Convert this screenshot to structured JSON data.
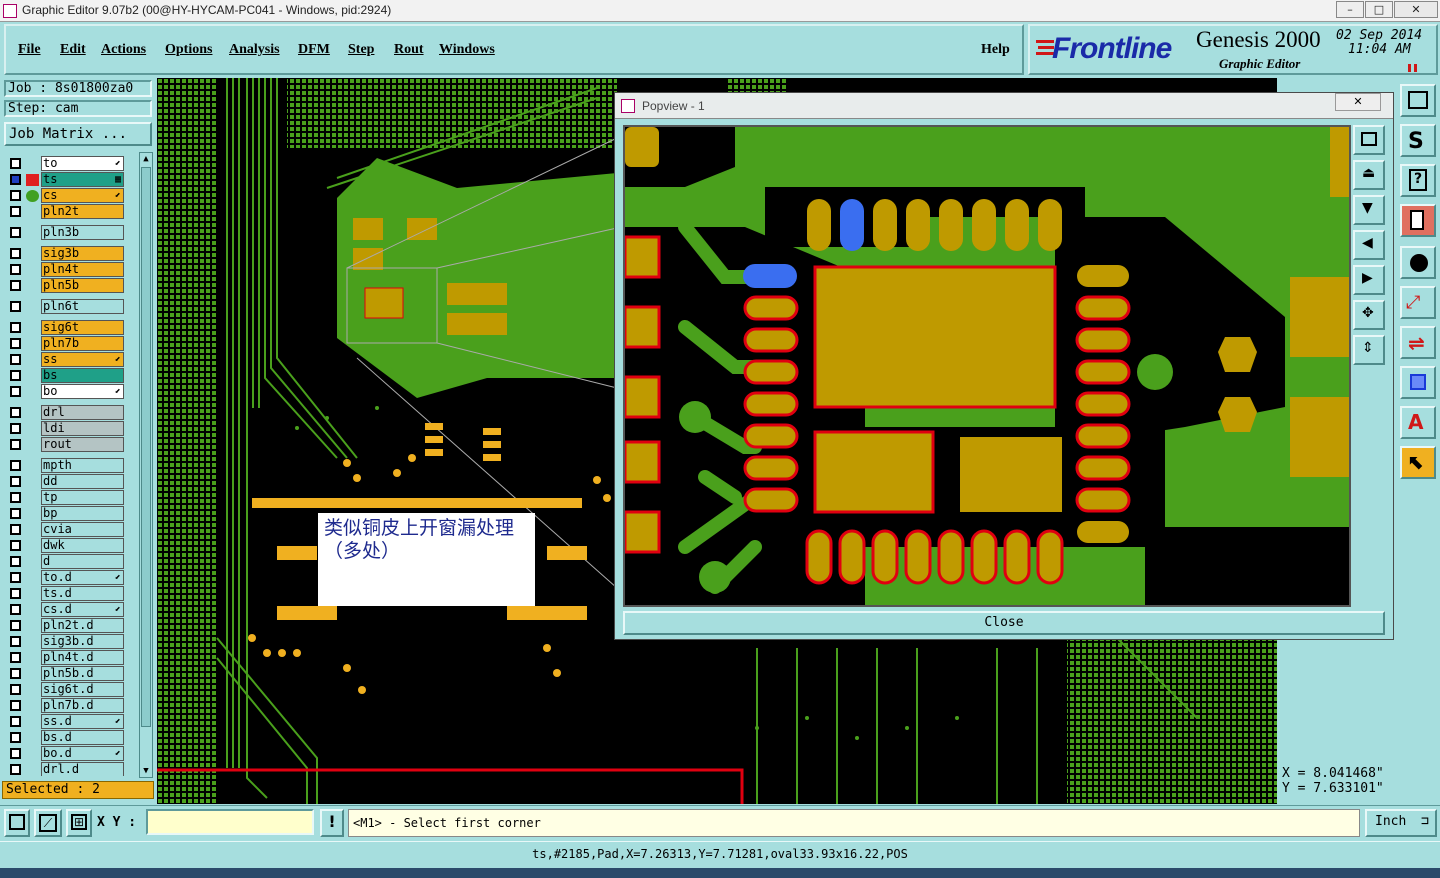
{
  "window": {
    "title": "Graphic Editor 9.07b2 (00@HY-HYCAM-PC041 - Windows, pid:2924)",
    "controls": [
      "–",
      "□",
      "✕"
    ]
  },
  "menu": {
    "items": [
      {
        "label": "File"
      },
      {
        "label": "Edit"
      },
      {
        "label": "Actions"
      },
      {
        "label": "Options"
      },
      {
        "label": "Analysis"
      },
      {
        "label": "DFM"
      },
      {
        "label": "Step"
      },
      {
        "label": "Rout"
      },
      {
        "label": "Windows"
      }
    ],
    "help": "Help"
  },
  "brand": {
    "logo": "Frontline",
    "product": "Genesis 2000",
    "subtitle": "Graphic Editor",
    "date": "02 Sep 2014",
    "time": "11:04 AM"
  },
  "job": {
    "job_label": "Job : 8s01800za0",
    "step_label": "Step: cam",
    "matrix_button": "Job Matrix ..."
  },
  "layers": [
    {
      "name": "to",
      "color": "#ffffff",
      "flag": "⬋"
    },
    {
      "name": "ts",
      "color": "#1fa088",
      "flag": "▦",
      "active": true
    },
    {
      "name": "cs",
      "color": "#f0b020",
      "flag": "⬋",
      "work": true
    },
    {
      "name": "pln2t",
      "color": "#f0b020",
      "flag": ""
    },
    {
      "name": "pln3b",
      "color": "#a6dede",
      "flag": "",
      "gap": true
    },
    {
      "name": "sig3b",
      "color": "#f0b020",
      "flag": "",
      "gap": true
    },
    {
      "name": "pln4t",
      "color": "#f0b020",
      "flag": ""
    },
    {
      "name": "pln5b",
      "color": "#f0b020",
      "flag": ""
    },
    {
      "name": "pln6t",
      "color": "#a6dede",
      "flag": "",
      "gap": true
    },
    {
      "name": "sig6t",
      "color": "#f0b020",
      "flag": "",
      "gap": true
    },
    {
      "name": "pln7b",
      "color": "#f0b020",
      "flag": ""
    },
    {
      "name": "ss",
      "color": "#f0b020",
      "flag": "⬋"
    },
    {
      "name": "bs",
      "color": "#1fa088",
      "flag": ""
    },
    {
      "name": "bo",
      "color": "#ffffff",
      "flag": "⬋"
    },
    {
      "name": "drl",
      "color": "#b4c4c4",
      "flag": "",
      "gap": true
    },
    {
      "name": "ldi",
      "color": "#b4c4c4",
      "flag": ""
    },
    {
      "name": "rout",
      "color": "#b4c4c4",
      "flag": ""
    },
    {
      "name": "mpth",
      "color": "#a6dede",
      "flag": "",
      "gap": true
    },
    {
      "name": "dd",
      "color": "#a6dede",
      "flag": ""
    },
    {
      "name": "tp",
      "color": "#a6dede",
      "flag": ""
    },
    {
      "name": "bp",
      "color": "#a6dede",
      "flag": ""
    },
    {
      "name": "cvia",
      "color": "#a6dede",
      "flag": ""
    },
    {
      "name": "dwk",
      "color": "#a6dede",
      "flag": ""
    },
    {
      "name": "d",
      "color": "#a6dede",
      "flag": ""
    },
    {
      "name": "to.d",
      "color": "#a6dede",
      "flag": "⬋"
    },
    {
      "name": "ts.d",
      "color": "#a6dede",
      "flag": ""
    },
    {
      "name": "cs.d",
      "color": "#a6dede",
      "flag": "⬋"
    },
    {
      "name": "pln2t.d",
      "color": "#a6dede",
      "flag": ""
    },
    {
      "name": "sig3b.d",
      "color": "#a6dede",
      "flag": ""
    },
    {
      "name": "pln4t.d",
      "color": "#a6dede",
      "flag": ""
    },
    {
      "name": "pln5b.d",
      "color": "#a6dede",
      "flag": ""
    },
    {
      "name": "sig6t.d",
      "color": "#a6dede",
      "flag": ""
    },
    {
      "name": "pln7b.d",
      "color": "#a6dede",
      "flag": ""
    },
    {
      "name": "ss.d",
      "color": "#a6dede",
      "flag": "⬋"
    },
    {
      "name": "bs.d",
      "color": "#a6dede",
      "flag": ""
    },
    {
      "name": "bo.d",
      "color": "#a6dede",
      "flag": "⬋"
    },
    {
      "name": "drl.d",
      "color": "#a6dede",
      "flag": ""
    }
  ],
  "selected": "Selected : 2",
  "popview": {
    "title": "Popview - 1",
    "close_label": "Close"
  },
  "annotation": "类似铜皮上开窗漏处理（多处）",
  "coords": {
    "x": "X = 8.041468\"",
    "y": "Y = 7.633101\""
  },
  "bottom": {
    "xy_label": "X Y :",
    "xy_value": "",
    "prompt": "<M1> - Select first corner",
    "units": "Inch"
  },
  "status": "ts,#2185,Pad,X=7.26313,Y=7.71281,oval33.93x16.22,POS",
  "colors": {
    "panel": "#a6dede",
    "copper": "#bf9a00",
    "board": "#4aa01c",
    "highlight": "#e00010",
    "selected_pad": "#3a6ef0"
  }
}
